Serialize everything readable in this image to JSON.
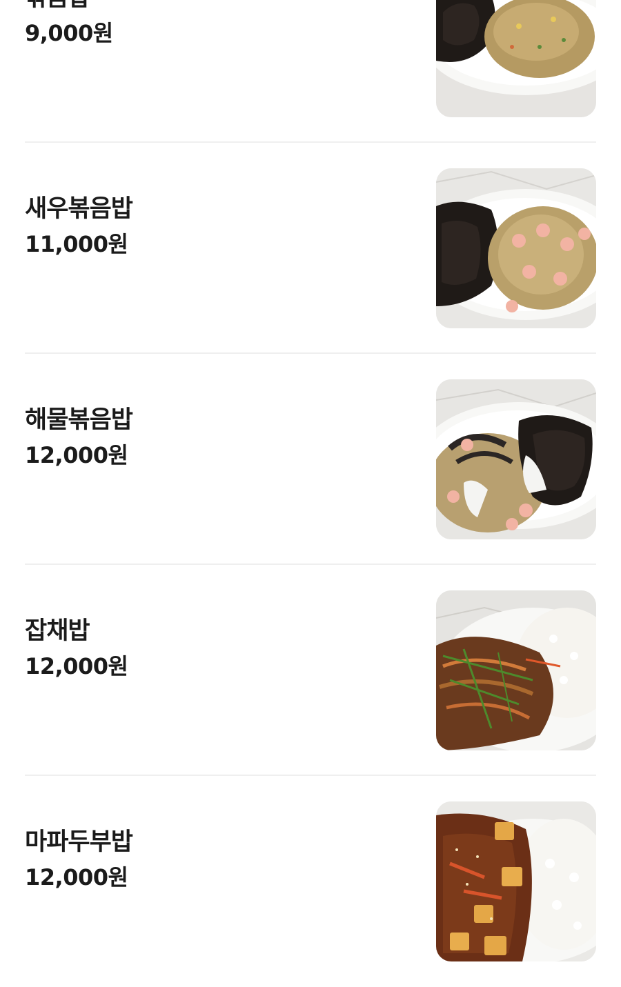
{
  "menu": {
    "items": [
      {
        "name": "볶음밥",
        "price": "9,000원",
        "photo": "fried-rice-photo"
      },
      {
        "name": "새우볶음밥",
        "price": "11,000원",
        "photo": "shrimp-fried-rice-photo"
      },
      {
        "name": "해물볶음밥",
        "price": "12,000원",
        "photo": "seafood-fried-rice-photo"
      },
      {
        "name": "잡채밥",
        "price": "12,000원",
        "photo": "japchae-rice-photo"
      },
      {
        "name": "마파두부밥",
        "price": "12,000원",
        "photo": "mapo-tofu-rice-photo"
      }
    ]
  },
  "colors": {
    "text": "#1b1b1b",
    "divider": "#efefef",
    "background": "#ffffff"
  }
}
